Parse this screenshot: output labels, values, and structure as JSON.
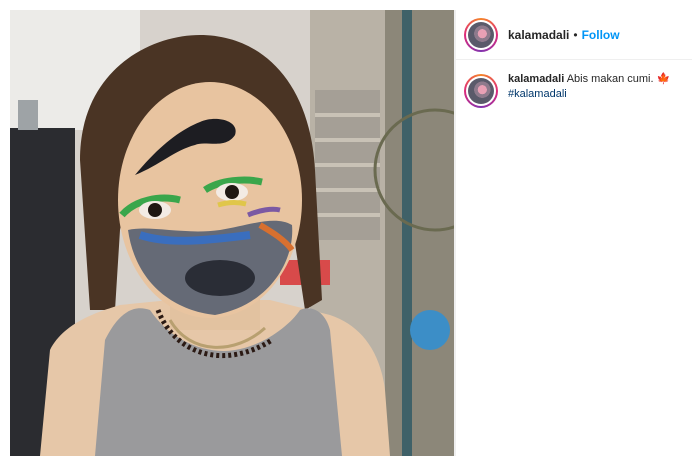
{
  "post": {
    "username": "kalamadali",
    "separator": "•",
    "follow_label": "Follow",
    "caption": {
      "username": "kalamadali",
      "text": "Abis makan cumi.",
      "emoji": "🍁",
      "hashtag": "#kalamadali"
    }
  },
  "colors": {
    "follow": "#0095f6",
    "hashtag": "#00376b",
    "divider": "#efefef"
  }
}
